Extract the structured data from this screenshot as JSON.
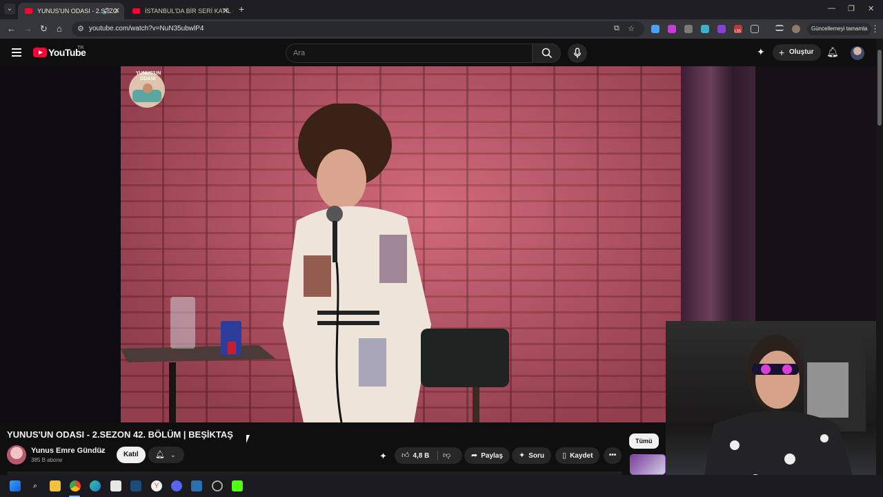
{
  "browser": {
    "tabs": [
      {
        "title": "YUNUS'UN ODASI - 2.SEZO",
        "active": true
      },
      {
        "title": "İSTANBUL'DA BİR SERİ KATİL - ",
        "active": false
      }
    ],
    "url": "youtube.com/watch?v=NuN35ubwlP4",
    "update_button": "Güncellemeyi tamamla",
    "extension_badge": "135"
  },
  "youtube": {
    "logo_text": "YouTube",
    "country_code": "TR",
    "search_placeholder": "Ara",
    "create_label": "Oluştur"
  },
  "video": {
    "title": "YUNUS'UN ODASI - 2.SEZON 42. BÖLÜM | BEŞİKTAŞ",
    "podcast_logo_text": "YUNUS'UN ODASI"
  },
  "channel": {
    "name": "Yunus Emre Gündüz",
    "subscribers": "385 B abone",
    "join_label": "Katıl"
  },
  "actions": {
    "likes": "4,8 B",
    "share": "Paylaş",
    "ask": "Soru",
    "save": "Kaydet"
  },
  "sidebar": {
    "filter_all": "Tümü"
  },
  "colors": {
    "brand": "#ff0033",
    "background": "#0f0f0f",
    "pill": "#272727"
  }
}
